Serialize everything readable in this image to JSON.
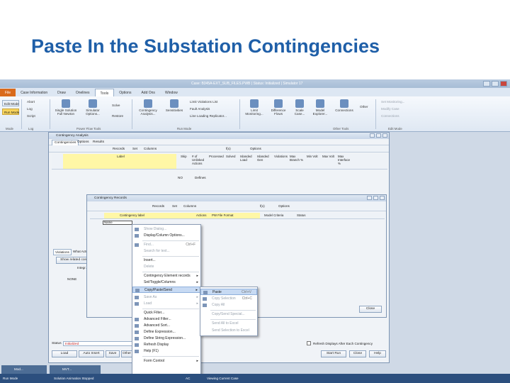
{
  "slide": {
    "title": "Paste In the Substation Contingencies"
  },
  "app": {
    "window_title": "Case: B345A-EXT_SUB_FILES.PWB | Status: Initialized | Simulator 17",
    "tabs": [
      "File",
      "Case Information",
      "Draw",
      "Onelines",
      "Tools",
      "Options",
      "Add Ons",
      "Window"
    ],
    "active_tab": "Tools",
    "ribbon": {
      "modes": {
        "edit": "Edit Mode",
        "run": "Run Mode",
        "group": "Mode"
      },
      "log_items": [
        "Abort",
        "Log",
        "Script"
      ],
      "log_group": "Log",
      "power_flow": [
        "Single Solution Full Newton",
        "Simulator Options...",
        "Solve",
        "Restore"
      ],
      "power_flow_group": "Power Flow Tools",
      "run_mode": [
        "Contingency Analysis...",
        "Sensitivities",
        "Limit Violations List",
        "Fault Analysis",
        "Line Loading Replicator..."
      ],
      "run_mode_group": "Run Mode",
      "other": [
        "Limit Monitoring...",
        "Difference Flows",
        "Scale Case...",
        "Model Explorer...",
        "Connections"
      ],
      "other_group": "Other Tools",
      "right": [
        "Set Monitoring...",
        "Modify Case",
        "Connections"
      ],
      "right_group": "Edit Mode",
      "other_label": "Other"
    },
    "status_bar": {
      "mode": "Run Mode",
      "message": "Solution Animation Stopped",
      "ac": "AC",
      "viewing": "Viewing Current Case"
    },
    "taskbar": [
      "Mod...",
      "MVT..."
    ]
  },
  "ca_window": {
    "title": "Contingency Analysis",
    "tabs": [
      "Contingencies",
      "Options",
      "Results"
    ],
    "toolbar": [
      "Records",
      "Set",
      "Columns",
      "f(x)",
      "Options"
    ],
    "columns": [
      "Label",
      "Skip",
      "# of Unlinked Actions",
      "Processed",
      "Solved",
      "Islanded Load",
      "Islanded Gen",
      "Violations",
      "Max Branch %",
      "Min Volt",
      "Max Volt",
      "Max Interface %"
    ],
    "row_skip": "NO",
    "row_processed": "Defines",
    "lower_tabs": [
      "Violations",
      "What Actu..."
    ],
    "show_related": "Show related cont.",
    "lower_label_1": "Integr...",
    "lower_label_2": "NONE",
    "status_label": "Status",
    "status_value": "Initialized",
    "refresh_label": "Refresh Displays After Each Contingency",
    "buttons": {
      "load": "Load",
      "auto_insert": "Auto Insert",
      "save": "Save",
      "other": "Other",
      "start_run": "Start Run",
      "close": "Close",
      "help": "Help"
    }
  },
  "records_window": {
    "title": "Contingency Records",
    "toolbar": [
      "Records",
      "Set",
      "Columns",
      "f(x)",
      "Options"
    ],
    "columns": [
      "Contingency label",
      "Actions",
      "PW File Format",
      "Model Criteria",
      "Status"
    ],
    "first_cell": "Name",
    "close_label": "Close"
  },
  "context_menu": {
    "items": [
      {
        "label": "Show Dialog...",
        "disabled": true
      },
      {
        "label": "Display/Column Options...",
        "disabled": false
      },
      {
        "label": "Find...",
        "shortcut": "Ctrl+F",
        "disabled": true
      },
      {
        "label": "Search for text...",
        "disabled": true
      },
      {
        "label": "Insert...",
        "disabled": false
      },
      {
        "label": "Delete",
        "disabled": true
      },
      {
        "label": "Contingency Element records",
        "disabled": false,
        "submenu": true
      },
      {
        "label": "Set/Toggle/Columns",
        "disabled": false,
        "submenu": true
      },
      {
        "label": "Copy/Paste/Send",
        "disabled": false,
        "submenu": true,
        "highlighted": true
      },
      {
        "label": "Save As",
        "disabled": true,
        "submenu": true
      },
      {
        "label": "Load",
        "disabled": true,
        "submenu": true
      },
      {
        "label": "Quick Filter...",
        "disabled": false
      },
      {
        "label": "Advanced Filter...",
        "disabled": false
      },
      {
        "label": "Advanced Sort...",
        "disabled": false
      },
      {
        "label": "Define Expression...",
        "disabled": false
      },
      {
        "label": "Define String Expression...",
        "disabled": false
      },
      {
        "label": "Refresh Display",
        "disabled": false
      },
      {
        "label": "Help (F1)",
        "disabled": false
      },
      {
        "label": "Form Control",
        "disabled": false,
        "submenu": true
      }
    ]
  },
  "submenu": {
    "items": [
      {
        "label": "Paste",
        "shortcut": "Ctrl+V",
        "disabled": false,
        "highlighted": true
      },
      {
        "label": "Copy Selection",
        "shortcut": "Ctrl+C",
        "disabled": true
      },
      {
        "label": "Copy All",
        "disabled": true
      },
      {
        "label": "Copy/Send Special...",
        "disabled": true
      },
      {
        "label": "Send All to Excel",
        "disabled": true
      },
      {
        "label": "Send Selection to Excel",
        "disabled": true
      }
    ]
  }
}
